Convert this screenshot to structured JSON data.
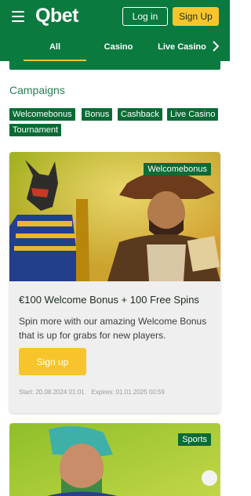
{
  "header": {
    "logo": "Qbet",
    "login_label": "Log in",
    "signup_label": "Sign Up",
    "tabs": [
      {
        "label": "All",
        "active": true
      },
      {
        "label": "Casino"
      },
      {
        "label": "Live Casino"
      }
    ],
    "next_icon": "chevron-right-icon",
    "menu_icon": "hamburger-icon"
  },
  "colors": {
    "brand_green": "#0a7a3f",
    "accent_yellow": "#f7c52b",
    "chip_green": "#0a6b35"
  },
  "campaigns": {
    "title": "Campaigns",
    "filters": [
      "Welcomebonus",
      "Bonus",
      "Cashback",
      "Live Casino",
      "Tournament"
    ]
  },
  "cards": [
    {
      "badge": "Welcomebonus",
      "title": "€100 Welcome Bonus + 100 Free Spins",
      "description": "Spin more with our amazing Welcome Bonus that is up for grabs for new players.",
      "cta": "Sign up",
      "start": "Start: 20.08.2024 01:01",
      "expires": "Expires: 01.01.2025 00:59"
    },
    {
      "badge": "Sports"
    }
  ]
}
